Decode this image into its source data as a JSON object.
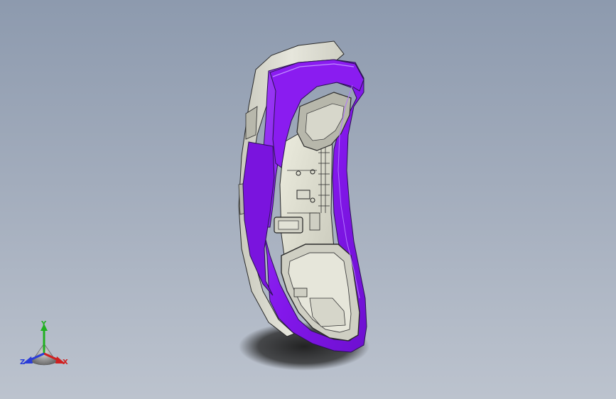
{
  "viewport": {
    "background_top": "#8d9aae",
    "background_bottom": "#bcc3ce"
  },
  "model": {
    "part_color": "#8a1cf0",
    "shell_color": "#dcdcd0",
    "edge_color": "#2a2a2a"
  },
  "triad": {
    "x_label": "X",
    "y_label": "Y",
    "z_label": "Z",
    "x_color": "#d02020",
    "y_color": "#21b021",
    "z_color": "#2a3cd8"
  }
}
